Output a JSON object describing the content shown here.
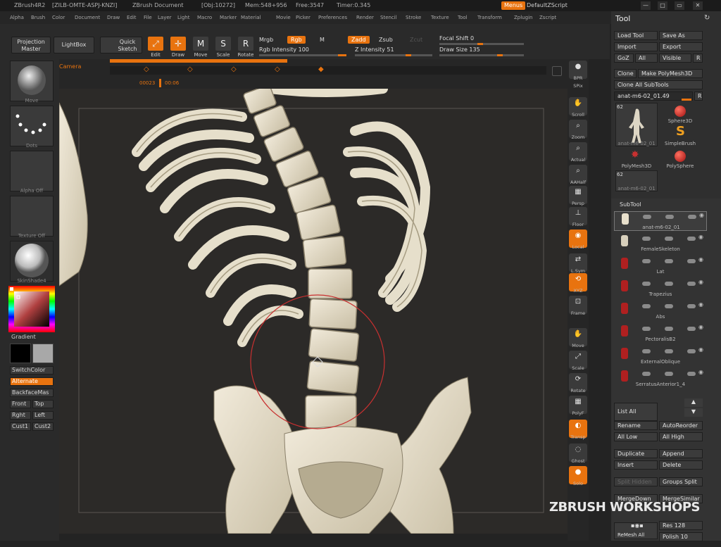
{
  "titlebar": {
    "app": "ZBrush4R2",
    "session": "[ZILB-OMTE-ASPJ-KNZI]",
    "document": "ZBrush Document",
    "obj": "[Obj:10272]",
    "mem": "Mem:548+956",
    "free": "Free:3547",
    "timer": "Timer:0.345",
    "menus_label": "Menus",
    "zscript_label": "DefaultZScript"
  },
  "menubar": [
    "Alpha",
    "Brush",
    "Color",
    "Document",
    "Draw",
    "Edit",
    "File",
    "Layer",
    "Light",
    "Macro",
    "Marker",
    "Material",
    "Movie",
    "Picker",
    "Preferences",
    "Render",
    "Stencil",
    "Stroke",
    "Texture",
    "Tool",
    "Transform",
    "Zplugin",
    "Zscript"
  ],
  "topshelf": {
    "projection_master": "Projection Master",
    "lightbox": "LightBox",
    "quick_sketch": "Quick Sketch",
    "edit": "Edit",
    "draw": "Draw",
    "move": "Move",
    "scale": "Scale",
    "rotate": "Rotate",
    "mrgb": "Mrgb",
    "rgb": "Rgb",
    "m": "M",
    "rgb_intensity": "Rgb Intensity 100",
    "zadd": "Zadd",
    "zsub": "Zsub",
    "zcut": "Zcut",
    "z_intensity": "Z Intensity 51",
    "focal_shift": "Focal Shift 0",
    "draw_size": "Draw Size 135"
  },
  "timeline": {
    "camera_label": "Camera",
    "frame": "00023",
    "time": "00:06"
  },
  "leftpanel": {
    "brush_label": "Move",
    "stroke_label": "Dots",
    "alpha_label": "Alpha Off",
    "texture_label": "Texture Off",
    "material_label": "SkinShade4",
    "gradient": "Gradient",
    "switchcolor": "SwitchColor",
    "alternate": "Alternate",
    "backfacemask": "BackfaceMas",
    "front": "Front",
    "top": "Top",
    "rght": "Rght",
    "left": "Left",
    "cust1": "Cust1",
    "cust2": "Cust2"
  },
  "rightshelf": [
    {
      "label": "BPR",
      "glyph": "●",
      "on": false
    },
    {
      "label": "SPix",
      "glyph": "",
      "on": false
    },
    {
      "label": "Scroll",
      "glyph": "✋",
      "on": false
    },
    {
      "label": "Zoom",
      "glyph": "⌕",
      "on": false
    },
    {
      "label": "Actual",
      "glyph": "⌕",
      "on": false
    },
    {
      "label": "AAHalf",
      "glyph": "⌕",
      "on": false
    },
    {
      "label": "Persp",
      "glyph": "▦",
      "on": false
    },
    {
      "label": "Floor",
      "glyph": "⊥",
      "on": false
    },
    {
      "label": "Local",
      "glyph": "◉",
      "on": true
    },
    {
      "label": "L.Sym",
      "glyph": "⇄",
      "on": false
    },
    {
      "label": "XYZ",
      "glyph": "⟲",
      "on": true
    },
    {
      "label": "Frame",
      "glyph": "⊡",
      "on": false
    },
    {
      "label": "Move",
      "glyph": "✋",
      "on": false
    },
    {
      "label": "Scale",
      "glyph": "⤢",
      "on": false
    },
    {
      "label": "Rotate",
      "glyph": "⟳",
      "on": false
    },
    {
      "label": "PolyF",
      "glyph": "▦",
      "on": false
    },
    {
      "label": "Transp",
      "glyph": "◐",
      "on": true
    },
    {
      "label": "Ghost",
      "glyph": "◌",
      "on": false
    },
    {
      "label": "Solo",
      "glyph": "●",
      "on": true
    }
  ],
  "toolpanel": {
    "title": "Tool",
    "load_tool": "Load Tool",
    "save_as": "Save As",
    "import": "Import",
    "export": "Export",
    "goz": "GoZ",
    "all": "All",
    "visible": "Visible",
    "r": "R",
    "clone": "Clone",
    "make_polymesh": "Make PolyMesh3D",
    "clone_all": "Clone All SubTools",
    "current_tool": "anat-m6-02_01.49",
    "thumb_count_1": "62",
    "thumb_count_2": "62",
    "tool_main": "anat-m6-02_01",
    "tool_sphere": "Sphere3D",
    "tool_simplebrush": "SimpleBrush",
    "tool_polymesh": "PolyMesh3D",
    "tool_polysphere": "PolySphere",
    "tool_small": "anat-m6-02_01",
    "subtool_title": "SubTool",
    "subtools": [
      {
        "name": "anat-m6-02_01",
        "color": "#e8e0cc"
      },
      {
        "name": "FemaleSkeleton",
        "color": "#d8d0bc"
      },
      {
        "name": "Lat",
        "color": "#b02020"
      },
      {
        "name": "Trapezius",
        "color": "#b02020"
      },
      {
        "name": "Abs",
        "color": "#b02020"
      },
      {
        "name": "PectoralisB2",
        "color": "#b02020"
      },
      {
        "name": "ExternalOblique",
        "color": "#b02020"
      },
      {
        "name": "SerratusAnterior1_4",
        "color": "#b02020"
      }
    ],
    "list_all": "List All",
    "rename": "Rename",
    "autoreorder": "AutoReorder",
    "all_low": "All Low",
    "all_high": "All High",
    "duplicate": "Duplicate",
    "append": "Append",
    "insert": "Insert",
    "delete": "Delete",
    "split_hidden": "Split Hidden",
    "groups_split": "Groups Split",
    "mergedown": "MergeDown",
    "mergesimilar": "MergeSimilar",
    "remesh_all": "ReMesh All",
    "res": "Res 128",
    "polish": "Polish 10"
  },
  "watermark": "ZBRUSH WORKSHOPS"
}
